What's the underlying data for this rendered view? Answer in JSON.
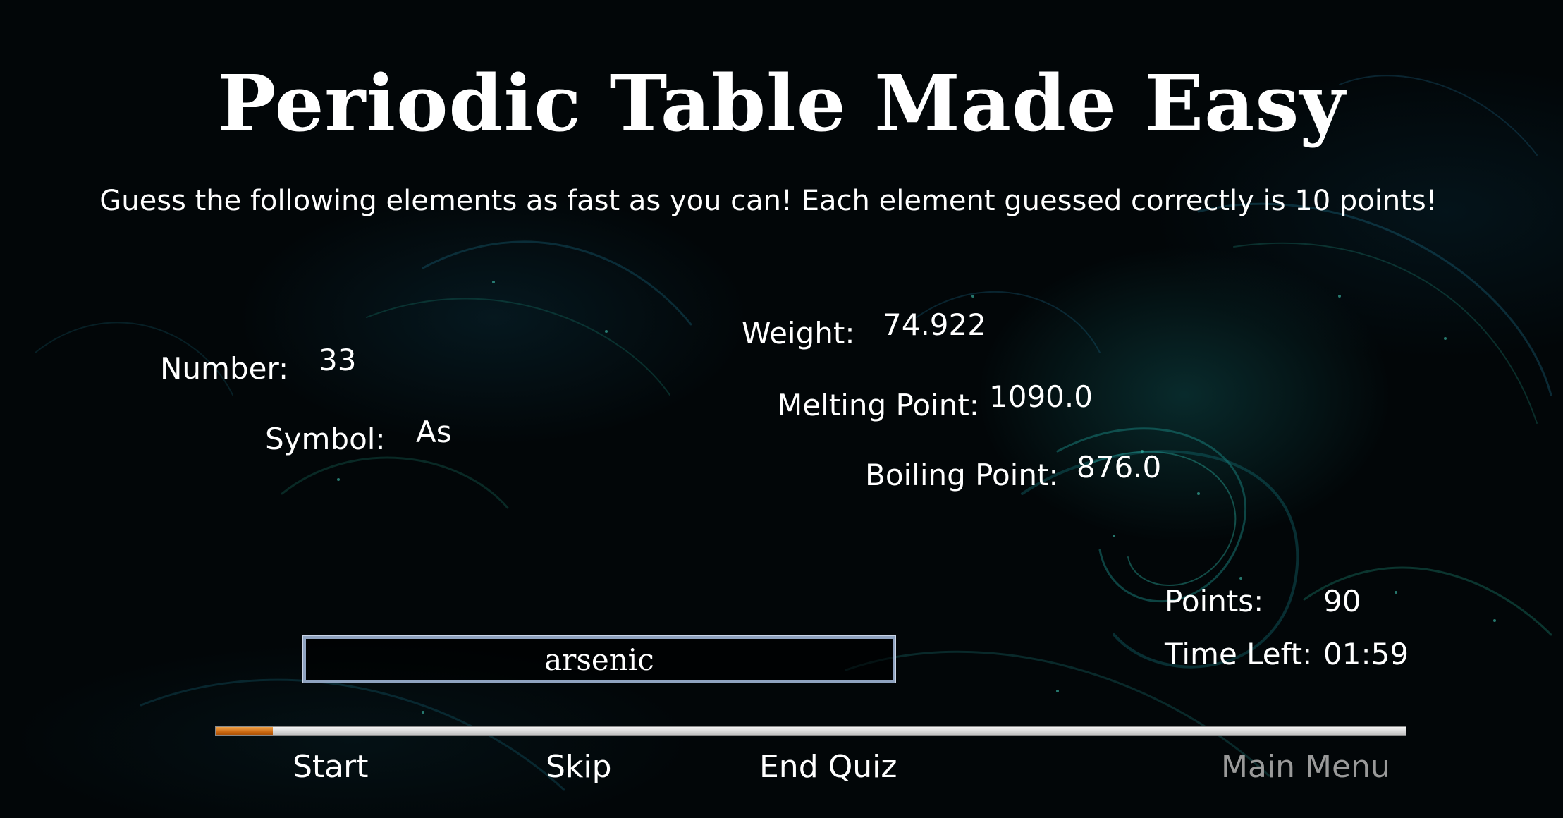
{
  "app": {
    "title": "Periodic Table Made Easy",
    "instructions": "Guess the following elements as fast as you can! Each element guessed correctly is 10 points!"
  },
  "element": {
    "number_label": "Number:",
    "number_value": "33",
    "symbol_label": "Symbol:",
    "symbol_value": "As",
    "weight_label": "Weight:",
    "weight_value": "74.922",
    "melting_label": "Melting Point:",
    "melting_value": "1090.0",
    "boiling_label": "Boiling Point:",
    "boiling_value": "876.0"
  },
  "score": {
    "points_label": "Points:",
    "points_value": "90",
    "time_label": "Time Left:",
    "time_value": "01:59"
  },
  "answer": {
    "value": "arsenic"
  },
  "progress": {
    "fraction": 0.048,
    "fill_color": "#d9741c"
  },
  "buttons": {
    "start": "Start",
    "skip": "Skip",
    "end_quiz": "End Quiz",
    "main_menu": "Main Menu"
  },
  "colors": {
    "background": "#020608",
    "text": "#ffffff",
    "disabled_text": "#9a9a9a",
    "input_border": "#8fa3c0"
  }
}
